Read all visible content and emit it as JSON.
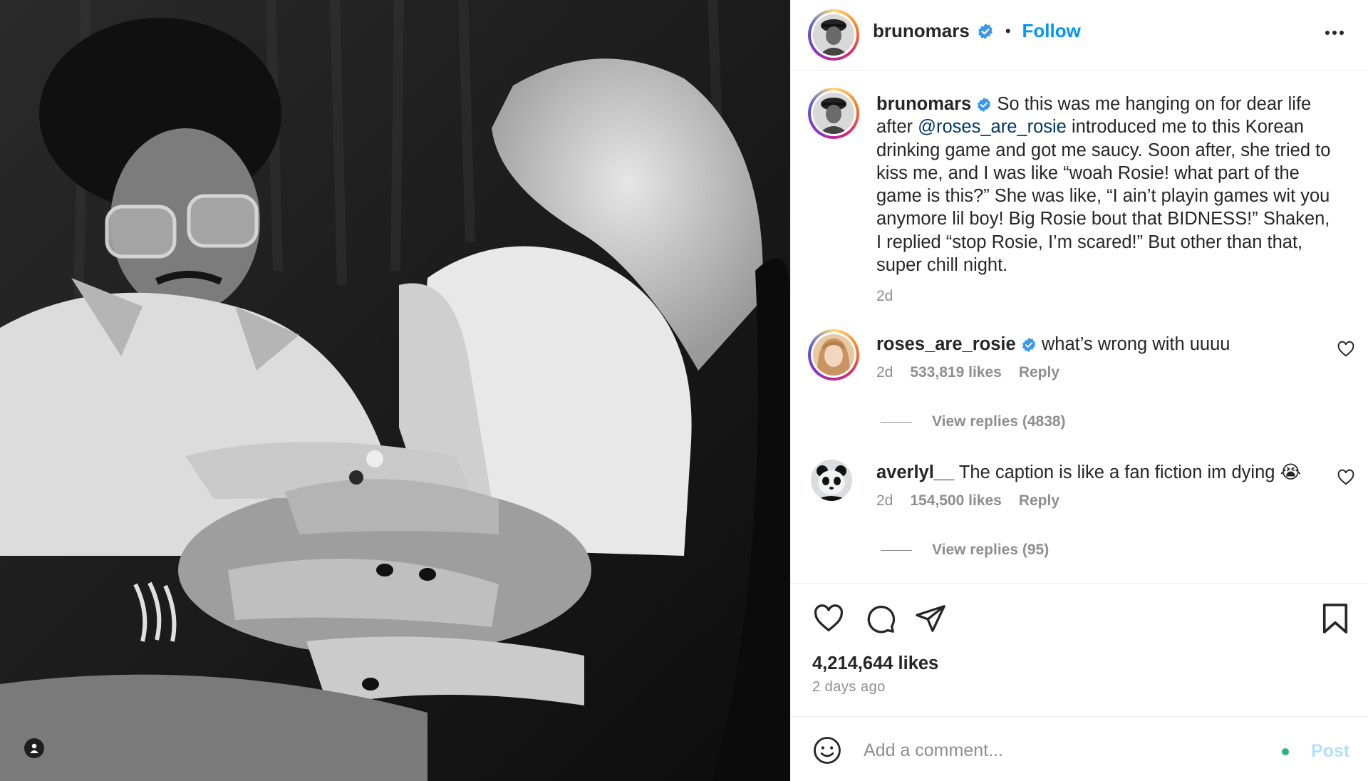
{
  "post": {
    "author": "brunomars",
    "follow_label": "Follow",
    "caption_parts": {
      "before_mention": "So this was me hanging on for dear life after ",
      "mention": "@roses_are_rosie",
      "after_mention": " introduced me to this Korean drinking game and got me saucy. Soon after, she tried to kiss me, and I was like “woah Rosie! what part of the game is this?” She was like, “I ain’t playin games wit you anymore lil boy! Big Rosie bout that BIDNESS!” Shaken, I replied “stop Rosie, I’m scared!” But other than that, super chill night."
    },
    "caption_time": "2d",
    "likes": "4,214,644 likes",
    "posted_ago": "2 days ago"
  },
  "comments": [
    {
      "username": "roses_are_rosie",
      "verified": true,
      "text": "what’s wrong with uuuu",
      "time": "2d",
      "likes": "533,819 likes",
      "reply_label": "Reply",
      "view_replies": "View replies (4838)"
    },
    {
      "username": "averlyl__",
      "verified": false,
      "text": "The caption is like a fan fiction im dying 😭",
      "time": "2d",
      "likes": "154,500 likes",
      "reply_label": "Reply",
      "view_replies": "View replies (95)"
    }
  ],
  "comment_bar": {
    "placeholder": "Add a comment...",
    "post_label": "Post"
  },
  "colors": {
    "link_blue": "#0095f6",
    "mention_blue": "#00376b",
    "muted_gray": "#8e8e8e",
    "verified_blue": "#3897f0",
    "post_disabled": "#b2dffc",
    "online_green": "#2bb673"
  },
  "icons": [
    "user-tag-icon",
    "verified-badge-icon",
    "more-options-icon",
    "heart-icon",
    "comment-icon",
    "share-icon",
    "bookmark-icon",
    "emoji-icon"
  ]
}
